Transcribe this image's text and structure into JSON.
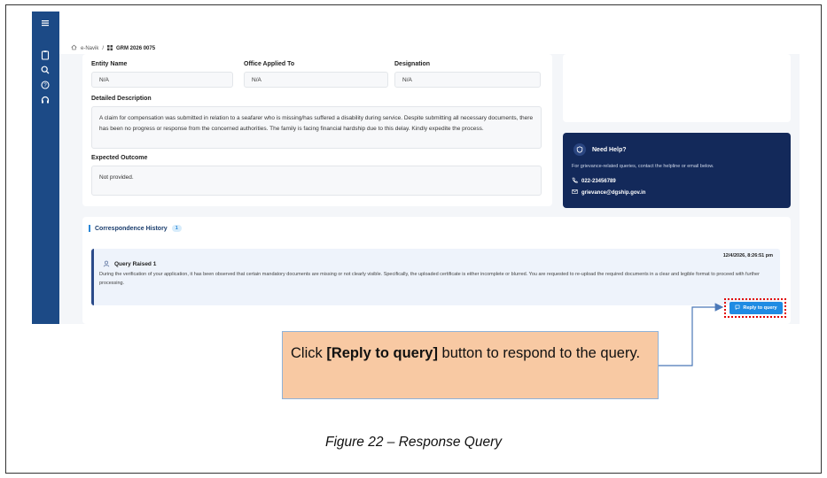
{
  "sidebar": {
    "icons": [
      "menu-icon",
      "clipboard-icon",
      "search-icon",
      "help-icon",
      "headset-icon"
    ]
  },
  "breadcrumb": {
    "home": "e-Navik",
    "separator": "/",
    "current": "GRM 2026 0075"
  },
  "entity": {
    "entity_label": "Entity Name",
    "entity_value": "N/A",
    "office_label": "Office Applied To",
    "office_value": "N/A",
    "designation_label": "Designation",
    "designation_value": "N/A"
  },
  "description": {
    "label": "Detailed Description",
    "text": "A claim for compensation was submitted in relation to a seafarer who is missing/has suffered a disability during service. Despite submitting all necessary documents, there has been no progress or response from the concerned authorities. The family is facing financial hardship due to this delay. Kindly expedite the process."
  },
  "outcome": {
    "label": "Expected Outcome",
    "text": "Not provided."
  },
  "help": {
    "title": "Need Help?",
    "text": "For grievance-related queries, contact the helpline or email below.",
    "phone": "022-23456789",
    "email": "grievance@dgship.gov.in"
  },
  "correspondence": {
    "title": "Correspondence History",
    "count": "1",
    "query_title": "Query Raised 1",
    "query_date": "12/4/2026, 8:26:51 pm",
    "query_text": "During the verification of your application, it has been observed that certain mandatory documents are missing or not clearly visible. Specifically, the uploaded certificate is either incomplete or blurred. You are requested to re-upload the required documents in a clear and legible format to proceed with further processing.",
    "reply_label": "Reply to query"
  },
  "callout": {
    "prefix": "Click ",
    "bold": "[Reply to query]",
    "suffix": " button to respond to the query."
  },
  "caption": "Figure 22 – Response Query",
  "colors": {
    "sidebar": "#1c4a86",
    "help_card": "#13295a",
    "button": "#1f8be3",
    "callout_bg": "#f8c9a3",
    "highlight": "#e10000"
  }
}
